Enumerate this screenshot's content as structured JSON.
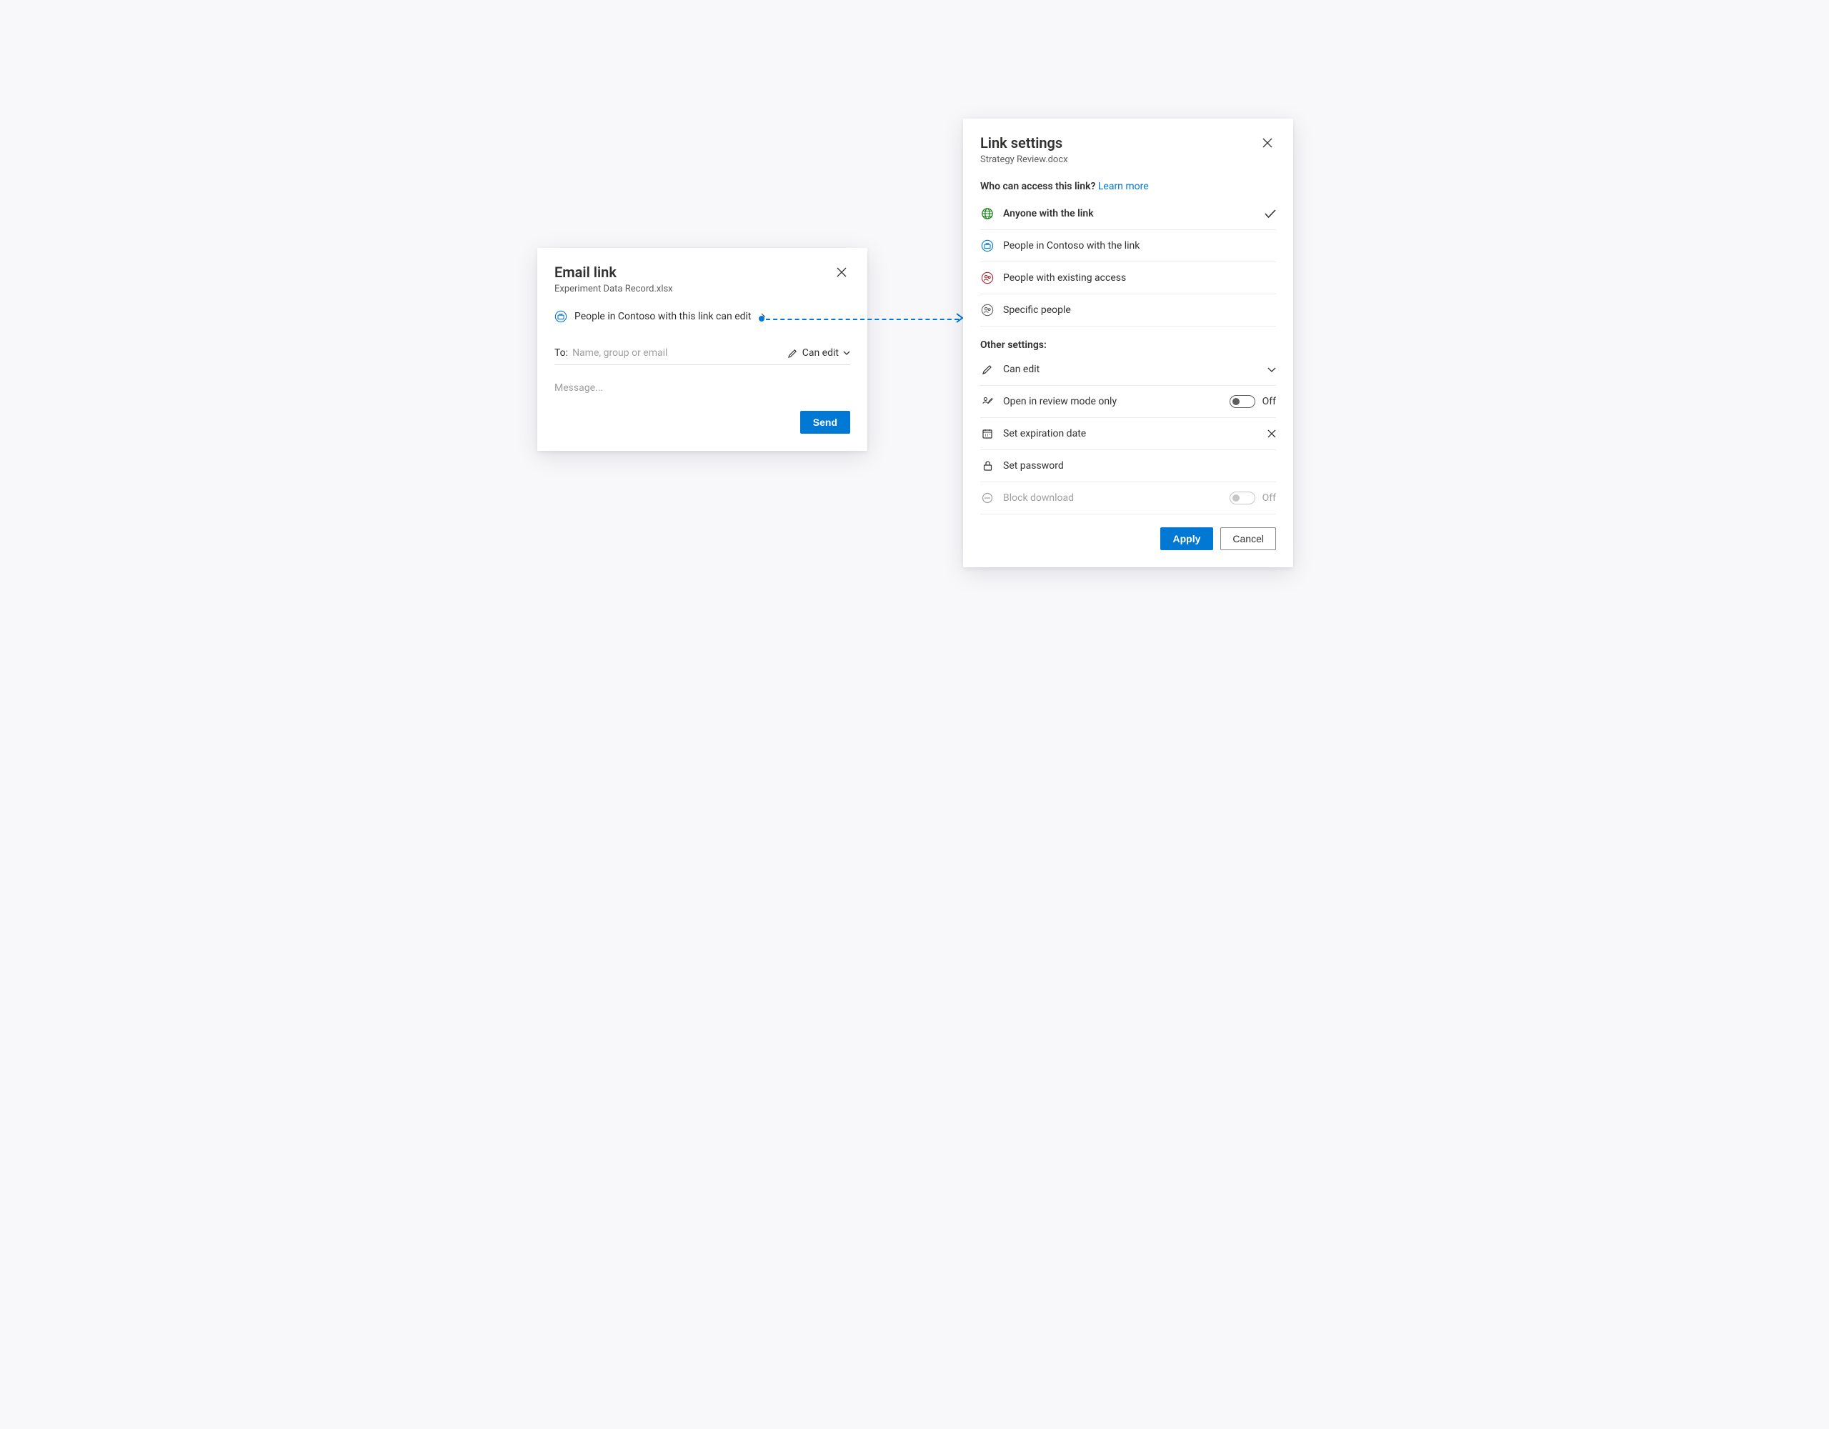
{
  "email": {
    "title": "Email link",
    "filename": "Experiment Data Record.xlsx",
    "scope_label": "People in Contoso with this link can edit",
    "to_label": "To:",
    "to_placeholder": "Name, group or email",
    "perm_label": "Can edit",
    "message_placeholder": "Message...",
    "send_label": "Send"
  },
  "settings": {
    "title": "Link settings",
    "filename": "Strategy Review.docx",
    "access_heading": "Who can access this link?",
    "learn_more": "Learn more",
    "options": [
      {
        "label": "Anyone with the link",
        "icon": "globe",
        "color": "#107c10",
        "selected": true
      },
      {
        "label": "People in Contoso with the link",
        "icon": "briefcase",
        "color": "#0078d4",
        "selected": false
      },
      {
        "label": "People with existing access",
        "icon": "people",
        "color": "#a4262c",
        "selected": false
      },
      {
        "label": "Specific people",
        "icon": "people",
        "color": "#605e5c",
        "selected": false
      }
    ],
    "other_heading": "Other settings:",
    "other": {
      "can_edit_label": "Can edit",
      "review_mode_label": "Open in review mode only",
      "review_mode_state": "Off",
      "expiration_label": "Set expiration date",
      "password_label": "Set password",
      "block_download_label": "Block download",
      "block_download_state": "Off"
    },
    "apply_label": "Apply",
    "cancel_label": "Cancel"
  }
}
